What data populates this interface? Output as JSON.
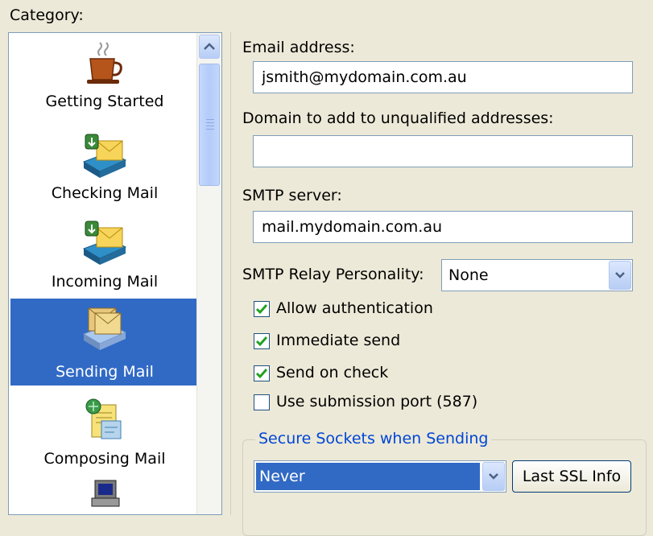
{
  "category": {
    "label": "Category:",
    "items": [
      {
        "label": "Getting Started",
        "icon": "coffee-cup-icon"
      },
      {
        "label": "Checking Mail",
        "icon": "checking-mail-icon"
      },
      {
        "label": "Incoming Mail",
        "icon": "incoming-mail-icon"
      },
      {
        "label": "Sending Mail",
        "icon": "sending-mail-icon",
        "selected": true
      },
      {
        "label": "Composing Mail",
        "icon": "composing-mail-icon"
      },
      {
        "label": "",
        "icon": "computer-icon"
      }
    ]
  },
  "form": {
    "email_label": "Email address:",
    "email_value": "jsmith@mydomain.com.au",
    "domain_label": "Domain to add to unqualified addresses:",
    "domain_value": "",
    "smtp_label": "SMTP server:",
    "smtp_value": "mail.mydomain.com.au",
    "relay_label": "SMTP Relay Personality:",
    "relay_value": "None",
    "checkboxes": [
      {
        "label": "Allow authentication",
        "checked": true
      },
      {
        "label": "Immediate send",
        "checked": true
      },
      {
        "label": "Send on check",
        "checked": true
      },
      {
        "label": "Use submission port (587)",
        "checked": false
      }
    ],
    "ssl_group_title": "Secure Sockets when Sending",
    "ssl_value": "Never",
    "ssl_info_button": "Last SSL Info"
  },
  "colors": {
    "selection": "#316ac5",
    "group_title": "#0046d5",
    "check": "#21a121"
  }
}
